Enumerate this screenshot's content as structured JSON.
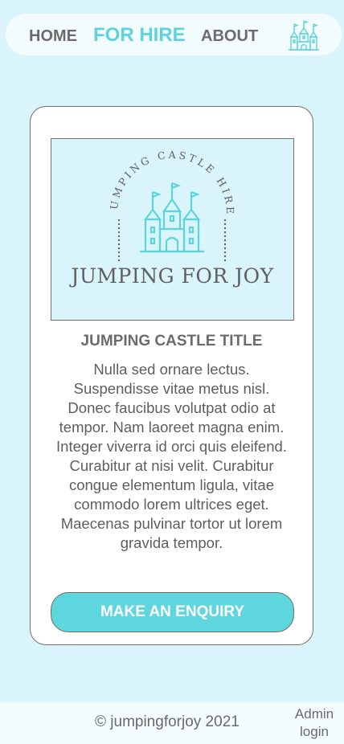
{
  "nav": {
    "home": "HOME",
    "for_hire": "FOR HIRE",
    "about": "ABOUT",
    "logo_icon": "castle-icon",
    "active_color": "#5dd3dc"
  },
  "card": {
    "logo": {
      "arc_text": "JUMPING CASTLE HIRE",
      "name": "JUMPING FOR JOY",
      "icon": "castle-icon"
    },
    "title": "JUMPING CASTLE TITLE",
    "description": "Nulla sed ornare lectus. Suspendisse vitae metus nisl. Donec faucibus volutpat odio at tempor. Nam laoreet magna enim. Integer viverra id orci quis eleifend. Curabitur at nisi velit. Curabitur congue elementum ligula, vitae commodo lorem ultrices eget. Maecenas pulvinar tortor ut lorem gravida tempor.",
    "button": "MAKE AN ENQUIRY"
  },
  "footer": {
    "copyright": "© jumpingforjoy 2021",
    "admin_login": "Admin login"
  },
  "colors": {
    "background": "#d9f5fb",
    "accent": "#5dd6de",
    "text": "#6b6b6b"
  }
}
